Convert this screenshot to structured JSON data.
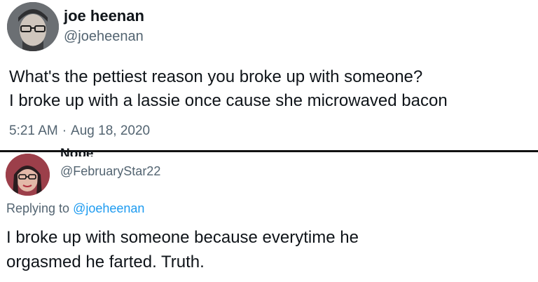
{
  "tweet1": {
    "name": "joe heenan",
    "handle": "@joeheenan",
    "text_lines": [
      "What's the pettiest reason you broke up with someone?",
      "I broke up with a lassie once cause she microwaved bacon"
    ],
    "time": "5:21 AM",
    "separator": "·",
    "date": "Aug 18, 2020"
  },
  "tweet2": {
    "name": "Nope",
    "handle": "@FebruaryStar22",
    "replying_prefix": "Replying to",
    "replying_handle": "@joeheenan",
    "text_lines": [
      "I broke up with someone because everytime he",
      "orgasmed he farted. Truth."
    ]
  },
  "colors": {
    "text": "#0f1419",
    "secondary": "#536471",
    "link": "#1d9bf0",
    "divider": "#111111"
  }
}
